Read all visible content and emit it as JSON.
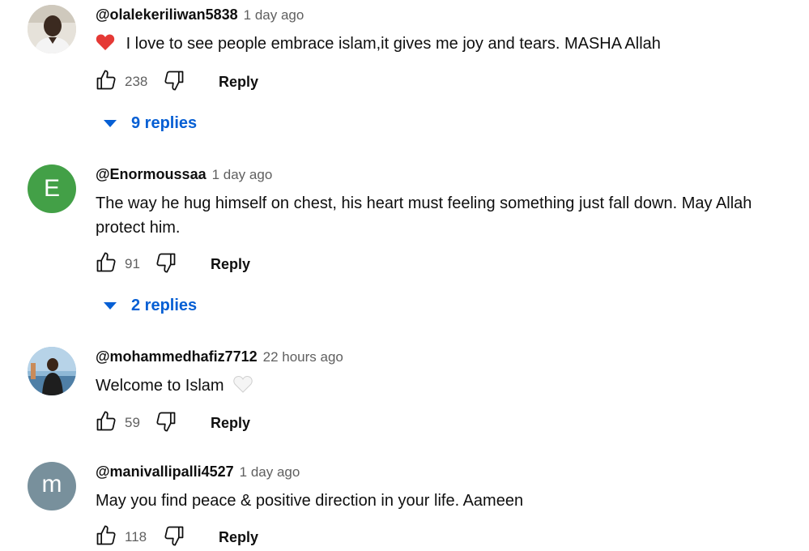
{
  "colors": {
    "link": "#065fd4",
    "muted": "#606060",
    "text": "#0f0f0f"
  },
  "comments": [
    {
      "author": "@olalekeriliwan5838",
      "time": "1 day ago",
      "emoji": "❤️",
      "text": "I love to see people embrace islam,it gives me joy and tears. MASHA Allah",
      "likes": "238",
      "reply_label": "Reply",
      "replies_label": "9 replies",
      "avatar": {
        "type": "photo",
        "name": "person-photo"
      }
    },
    {
      "author": "@Enormoussaa",
      "time": "1 day ago",
      "text": "The way he hug himself on chest, his heart must feeling something just fall down. May Allah protect him.",
      "likes": "91",
      "reply_label": "Reply",
      "replies_label": "2 replies",
      "avatar": {
        "type": "letter",
        "letter": "E",
        "color": "#43a047"
      }
    },
    {
      "author": "@mohammedhafiz7712",
      "time": "22 hours ago",
      "text": "Welcome to Islam",
      "emoji_after": "🤍",
      "likes": "59",
      "reply_label": "Reply",
      "avatar": {
        "type": "photo",
        "name": "person-photo"
      }
    },
    {
      "author": "@manivallipalli4527",
      "time": "1 day ago",
      "text": "May you find peace & positive direction in your life. Aameen",
      "likes": "118",
      "reply_label": "Reply",
      "avatar": {
        "type": "letter",
        "letter": "m",
        "color": "#78909c"
      }
    }
  ]
}
